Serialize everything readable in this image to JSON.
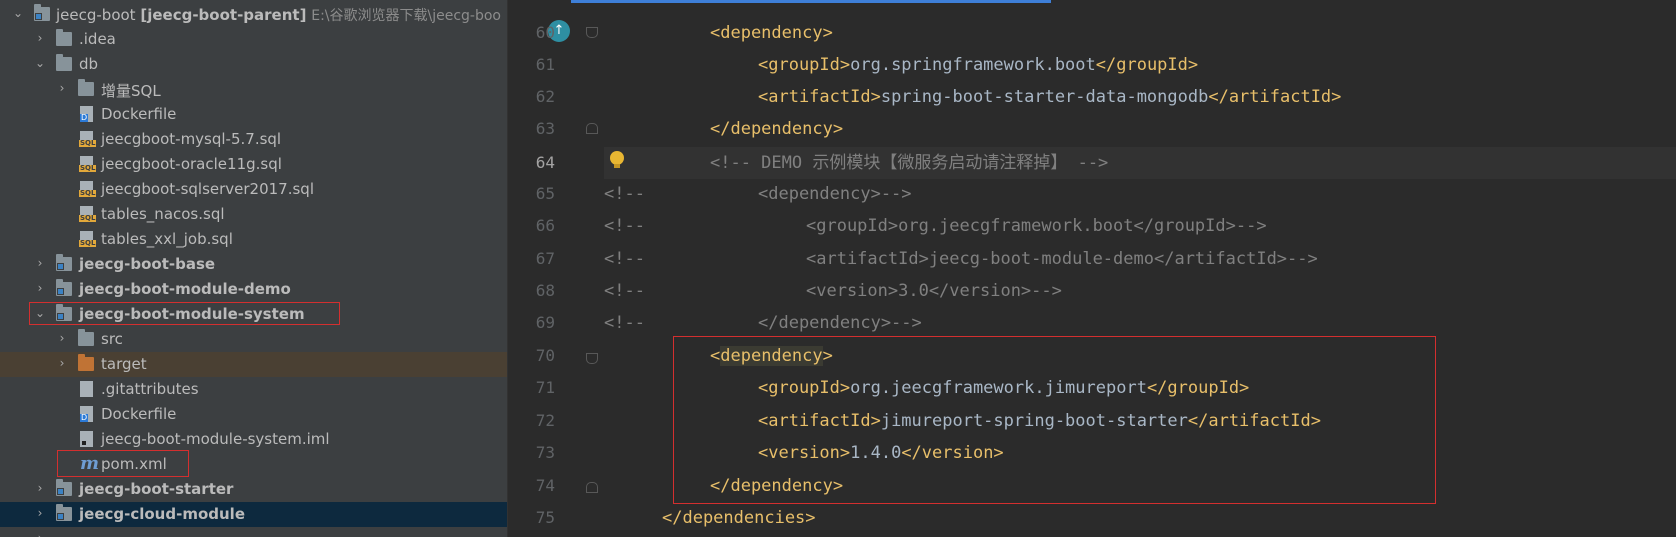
{
  "project_tree": {
    "root": {
      "name": "jeecg-boot",
      "module": "[jeecg-boot-parent]",
      "path_hint": "E:\\谷歌浏览器下载\\jeecg-boo"
    },
    "items": [
      {
        "label": ".idea"
      },
      {
        "label": "db"
      },
      {
        "label": "增量SQL"
      },
      {
        "label": "Dockerfile"
      },
      {
        "label": "jeecgboot-mysql-5.7.sql"
      },
      {
        "label": "jeecgboot-oracle11g.sql"
      },
      {
        "label": "jeecgboot-sqlserver2017.sql"
      },
      {
        "label": "tables_nacos.sql"
      },
      {
        "label": "tables_xxl_job.sql"
      },
      {
        "label": "jeecg-boot-base"
      },
      {
        "label": "jeecg-boot-module-demo"
      },
      {
        "label": "jeecg-boot-module-system"
      },
      {
        "label": "src"
      },
      {
        "label": "target"
      },
      {
        "label": ".gitattributes"
      },
      {
        "label": "Dockerfile"
      },
      {
        "label": "jeecg-boot-module-system.iml"
      },
      {
        "label": "pom.xml"
      },
      {
        "label": "jeecg-boot-starter"
      },
      {
        "label": "jeecg-cloud-module"
      }
    ]
  },
  "editor": {
    "lines": [
      {
        "num": "60",
        "segments": [
          {
            "c": "t",
            "text": "<dependency>"
          }
        ]
      },
      {
        "num": "61",
        "segments": [
          {
            "c": "t",
            "text": "<groupId>"
          },
          {
            "c": "tx",
            "text": "org.springframework.boot"
          },
          {
            "c": "t",
            "text": "</groupId>"
          }
        ]
      },
      {
        "num": "62",
        "segments": [
          {
            "c": "t",
            "text": "<artifactId>"
          },
          {
            "c": "tx",
            "text": "spring-boot-starter-data-mongodb"
          },
          {
            "c": "t",
            "text": "</artifactId>"
          }
        ]
      },
      {
        "num": "63",
        "segments": [
          {
            "c": "t",
            "text": "</dependency>"
          }
        ]
      },
      {
        "num": "64",
        "segments": [
          {
            "c": "cm",
            "text": "<!-- DEMO 示例模块【微服务启动请注释掉】 -->"
          }
        ]
      },
      {
        "num": "65",
        "segments": [
          {
            "c": "cm",
            "text": "<!--"
          },
          {
            "c": "cm",
            "text": "<dependency>-->"
          }
        ]
      },
      {
        "num": "66",
        "segments": [
          {
            "c": "cm",
            "text": "<!--"
          },
          {
            "c": "cm",
            "text": "<groupId>org.jeecgframework.boot</groupId>-->"
          }
        ]
      },
      {
        "num": "67",
        "segments": [
          {
            "c": "cm",
            "text": "<!--"
          },
          {
            "c": "cm",
            "text": "<artifactId>jeecg-boot-module-demo</artifactId>-->"
          }
        ]
      },
      {
        "num": "68",
        "segments": [
          {
            "c": "cm",
            "text": "<!--"
          },
          {
            "c": "cm",
            "text": "<version>3.0</version>-->"
          }
        ]
      },
      {
        "num": "69",
        "segments": [
          {
            "c": "cm",
            "text": "<!--"
          },
          {
            "c": "cm",
            "text": "</dependency>-->"
          }
        ]
      },
      {
        "num": "70",
        "segments": [
          {
            "c": "t",
            "text": "<"
          },
          {
            "c": "t hl",
            "text": "dependency"
          },
          {
            "c": "t",
            "text": ">"
          }
        ]
      },
      {
        "num": "71",
        "segments": [
          {
            "c": "t",
            "text": "<groupId>"
          },
          {
            "c": "tx",
            "text": "org.jeecgframework.jimureport"
          },
          {
            "c": "t",
            "text": "</groupId>"
          }
        ]
      },
      {
        "num": "72",
        "segments": [
          {
            "c": "t",
            "text": "<artifactId>"
          },
          {
            "c": "tx",
            "text": "jimureport-spring-boot-starter"
          },
          {
            "c": "t",
            "text": "</artifactId>"
          }
        ]
      },
      {
        "num": "73",
        "segments": [
          {
            "c": "t",
            "text": "<version>"
          },
          {
            "c": "tx",
            "text": "1.4.0"
          },
          {
            "c": "t",
            "text": "</version>"
          }
        ]
      },
      {
        "num": "74",
        "segments": [
          {
            "c": "t",
            "text": "</dependency>"
          }
        ]
      },
      {
        "num": "75",
        "segments": [
          {
            "c": "t",
            "text": "</dependencies>"
          }
        ]
      }
    ]
  }
}
